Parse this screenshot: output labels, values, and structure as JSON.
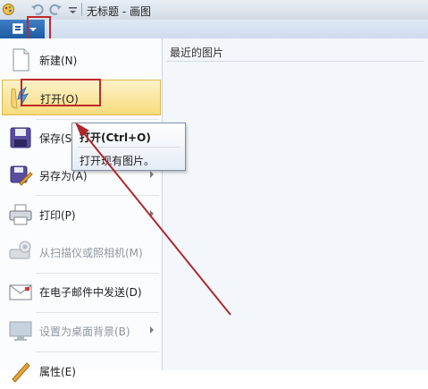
{
  "title_bar": {
    "title": "无标题 - 画图"
  },
  "app_menu": {
    "recent_heading": "最近的图片",
    "items": [
      {
        "label": "新建(N)",
        "icon": "new-file-icon",
        "enabled": true,
        "submenu": false
      },
      {
        "label": "打开(O)",
        "icon": "open-folder-icon",
        "enabled": true,
        "submenu": false,
        "highlighted": true
      },
      {
        "label": "保存(S)",
        "icon": "save-disk-icon",
        "enabled": true,
        "submenu": false
      },
      {
        "label": "另存为(A)",
        "icon": "save-as-icon",
        "enabled": true,
        "submenu": true
      },
      {
        "label": "打印(P)",
        "icon": "printer-icon",
        "enabled": true,
        "submenu": true
      },
      {
        "label": "从扫描仪或照相机(M)",
        "icon": "scanner-icon",
        "enabled": false,
        "submenu": false
      },
      {
        "label": "在电子邮件中发送(D)",
        "icon": "email-icon",
        "enabled": true,
        "submenu": false
      },
      {
        "label": "设置为桌面背景(B)",
        "icon": "desktop-background-icon",
        "enabled": false,
        "submenu": true
      },
      {
        "label": "属性(E)",
        "icon": "properties-icon",
        "enabled": true,
        "submenu": false
      }
    ]
  },
  "tooltip": {
    "title": "打开(Ctrl+O)",
    "body": "打开现有图片。"
  },
  "colors": {
    "annotation": "#c0282a",
    "hover_fill": "#f8dc7c",
    "menu_button": "#1d5aa3"
  }
}
